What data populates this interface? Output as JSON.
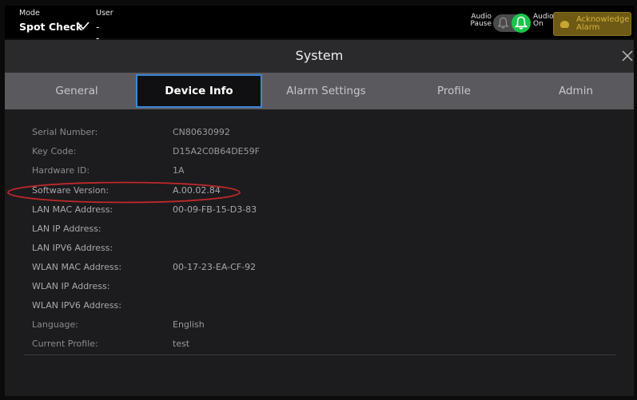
{
  "topbar": {
    "mode_caption": "Mode",
    "mode_value": "Spot Check",
    "user_caption": "User",
    "user_value": "------",
    "audio_pause_label_1": "Audio",
    "audio_pause_label_2": "Pause",
    "audio_on_label_1": "Audio",
    "audio_on_label_2": "On",
    "ack_label_1": "Acknowledge",
    "ack_label_2": "Alarm",
    "colors": {
      "audio_on": "#19c44b",
      "ack_bg": "#6e5a14",
      "ack_text": "#d4b53c"
    }
  },
  "dialog": {
    "title": "System",
    "tabs": [
      {
        "label": "General",
        "active": false
      },
      {
        "label": "Device Info",
        "active": true
      },
      {
        "label": "Alarm Settings",
        "active": false
      },
      {
        "label": "Profile",
        "active": false
      },
      {
        "label": "Admin",
        "active": false
      }
    ],
    "active_tab_color": "#3e86d6",
    "fields": [
      {
        "key": "Serial Number:",
        "value": "CN80630992"
      },
      {
        "key": "Key Code:",
        "value": "D15A2C0B64DE59F"
      },
      {
        "key": "Hardware ID:",
        "value": "1A"
      },
      {
        "key": "Software Version:",
        "value": "A.00.02.84"
      },
      {
        "key": "LAN MAC Address:",
        "value": "00-09-FB-15-D3-83"
      },
      {
        "key": "LAN IP Address:",
        "value": ""
      },
      {
        "key": "LAN IPV6 Address:",
        "value": ""
      },
      {
        "key": "WLAN MAC Address:",
        "value": "00-17-23-EA-CF-92"
      },
      {
        "key": "WLAN IP Address:",
        "value": ""
      },
      {
        "key": "WLAN IPV6 Address:",
        "value": ""
      },
      {
        "key": "Language:",
        "value": "English"
      },
      {
        "key": "Current Profile:",
        "value": "test"
      }
    ],
    "highlight_color": "#c0282a"
  }
}
